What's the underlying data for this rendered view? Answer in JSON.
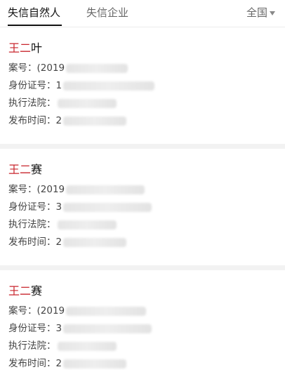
{
  "tabs": [
    {
      "label": "失信自然人",
      "active": true
    },
    {
      "label": "失信企业",
      "active": false
    }
  ],
  "region": {
    "label": "全国"
  },
  "labels": {
    "case_no": "案号：",
    "id_no": "身份证号：",
    "court": "执行法院：",
    "publish_time": "发布时间："
  },
  "records": [
    {
      "name_highlight": "王二",
      "name_rest": "叶",
      "case_prefix": "(2019",
      "id_prefix": "1",
      "court_prefix": "",
      "time_prefix": "2"
    },
    {
      "name_highlight": "王二",
      "name_rest": "赛",
      "case_prefix": "(2019",
      "id_prefix": "3",
      "court_prefix": "",
      "time_prefix": "2"
    },
    {
      "name_highlight": "王二",
      "name_rest": "赛",
      "case_prefix": "(2019",
      "id_prefix": "3",
      "court_prefix": "",
      "time_prefix": "2"
    }
  ],
  "colors": {
    "highlight": "#c8262d",
    "text": "#222222",
    "muted": "#666666"
  }
}
